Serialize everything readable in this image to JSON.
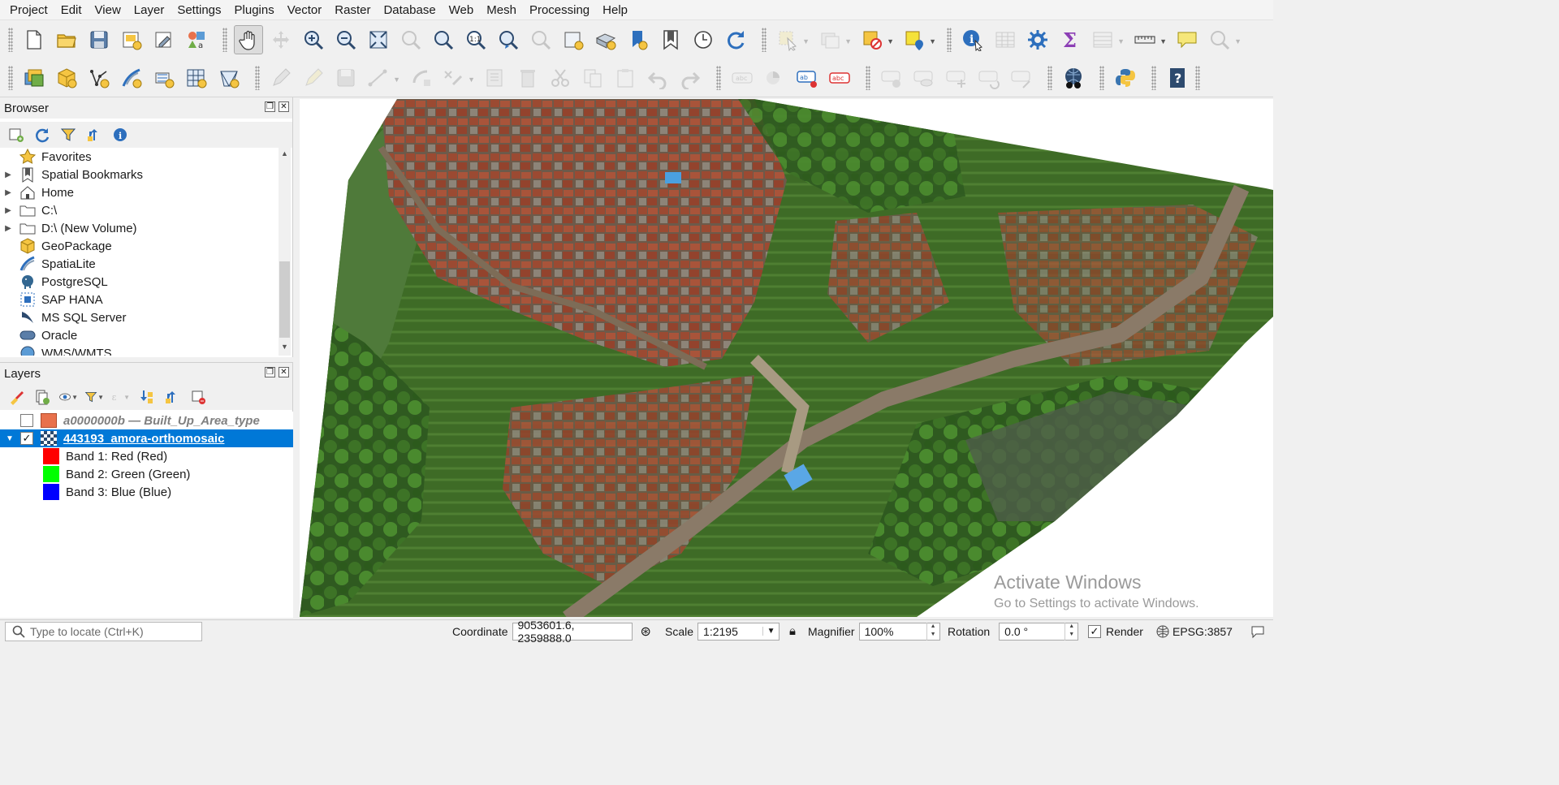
{
  "menubar": {
    "items": [
      "Project",
      "Edit",
      "View",
      "Layer",
      "Settings",
      "Plugins",
      "Vector",
      "Raster",
      "Database",
      "Web",
      "Mesh",
      "Processing",
      "Help"
    ]
  },
  "toolbar1": {
    "icons": [
      "new-project-icon",
      "open-project-icon",
      "save-project-icon",
      "new-print-layout-icon",
      "layout-manager-icon",
      "style-manager-icon",
      "pan-icon",
      "pan-to-selection-icon",
      "zoom-in-icon",
      "zoom-out-icon",
      "zoom-full-icon",
      "zoom-to-selection-icon",
      "zoom-to-layer-icon",
      "zoom-native-resolution-icon",
      "zoom-last-icon",
      "zoom-next-icon",
      "new-map-view-icon",
      "new-3d-map-view-icon",
      "new-bookmark-icon",
      "show-bookmarks-icon",
      "temporal-controller-icon",
      "refresh-icon",
      "select-features-icon",
      "deselect-icon",
      "deselect-all-icon",
      "select-by-location-icon",
      "identify-icon",
      "attribute-table-icon",
      "settings-gear-icon",
      "statistics-sum-icon",
      "open-table-icon",
      "measure-icon",
      "map-tips-icon",
      "find-icon"
    ]
  },
  "toolbar2": {
    "icons": [
      "data-source-manager-icon",
      "new-geopackage-layer-icon",
      "new-shapefile-layer-icon",
      "new-spatialite-layer-icon",
      "new-temporary-layer-icon",
      "new-virtual-layer-icon",
      "new-mesh-layer-icon",
      "digitize-icon",
      "toggle-editing-icon",
      "save-edits-icon",
      "add-feature-icon",
      "vertex-tool-icon",
      "modify-attributes-icon",
      "delete-selected-icon",
      "cut-features-icon",
      "copy-features-icon",
      "paste-features-icon",
      "undo-icon",
      "redo-icon",
      "label-tool-icon",
      "diagram-tool-icon",
      "layer-labeling-icon",
      "layer-rule-labeling-icon",
      "pin-labels-icon",
      "show-hide-labels-icon",
      "move-label-icon",
      "rotate-label-icon",
      "change-label-icon",
      "quickmapservices-icon",
      "python-console-icon",
      "help-icon"
    ]
  },
  "browser": {
    "title": "Browser",
    "items": [
      {
        "label": "Favorites",
        "icon": "star-icon",
        "expandable": false
      },
      {
        "label": "Spatial Bookmarks",
        "icon": "bookmark-icon",
        "expandable": true
      },
      {
        "label": "Home",
        "icon": "home-icon",
        "expandable": true
      },
      {
        "label": "C:\\",
        "icon": "folder-icon",
        "expandable": true
      },
      {
        "label": "D:\\ (New Volume)",
        "icon": "folder-icon",
        "expandable": true
      },
      {
        "label": "GeoPackage",
        "icon": "geopackage-icon",
        "expandable": false
      },
      {
        "label": "SpatiaLite",
        "icon": "spatialite-icon",
        "expandable": false
      },
      {
        "label": "PostgreSQL",
        "icon": "postgresql-icon",
        "expandable": false
      },
      {
        "label": "SAP HANA",
        "icon": "sap-hana-icon",
        "expandable": false
      },
      {
        "label": "MS SQL Server",
        "icon": "mssql-icon",
        "expandable": false
      },
      {
        "label": "Oracle",
        "icon": "oracle-icon",
        "expandable": false
      },
      {
        "label": "WMS/WMTS",
        "icon": "globe-icon",
        "expandable": false
      }
    ]
  },
  "layers": {
    "title": "Layers",
    "items": [
      {
        "name": "a0000000b — Built_Up_Area_type",
        "checked": false,
        "color": "#e8714c"
      },
      {
        "name": "443193_amora-orthomosaic",
        "checked": true,
        "selected": true
      }
    ],
    "bands": [
      {
        "label": "Band 1: Red (Red)",
        "color": "#ff0000"
      },
      {
        "label": "Band 2: Green (Green)",
        "color": "#00ff00"
      },
      {
        "label": "Band 3: Blue (Blue)",
        "color": "#0000ff"
      }
    ]
  },
  "watermark": {
    "line1": "Activate Windows",
    "line2": "Go to Settings to activate Windows."
  },
  "statusbar": {
    "locator_placeholder": "Type to locate (Ctrl+K)",
    "coordinate_label": "Coordinate",
    "coordinate_value": "9053601.6, 2359888.0",
    "scale_label": "Scale",
    "scale_value": "1:2195",
    "magnifier_label": "Magnifier",
    "magnifier_value": "100%",
    "rotation_label": "Rotation",
    "rotation_value": "0.0 °",
    "render_label": "Render",
    "render_checked": true,
    "crs": "EPSG:3857"
  },
  "colors": {
    "selection": "#0078d7",
    "road": "#8a7a68",
    "vegetation": "#3f6a2a",
    "roof": "#9b4a32"
  }
}
